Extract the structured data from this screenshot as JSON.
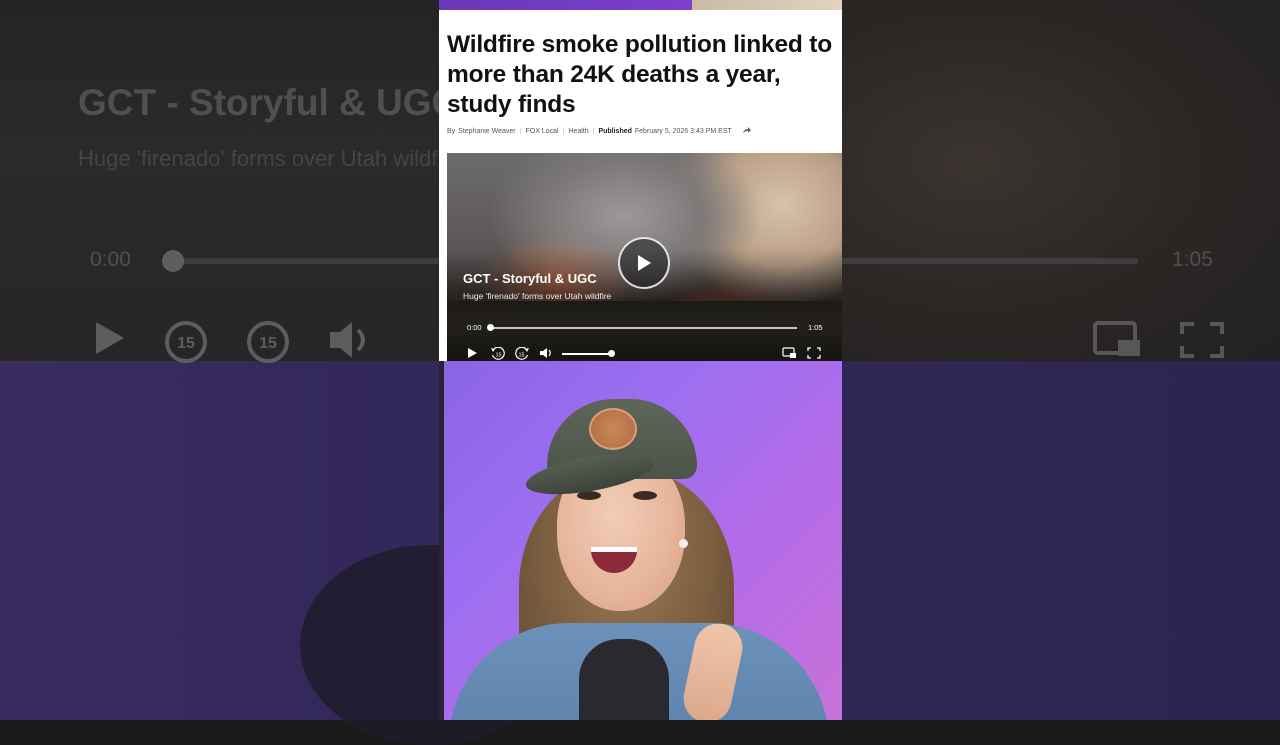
{
  "background_ghost": {
    "title": "GCT - Storyful & UGC",
    "subtitle": "Huge 'firenado' forms over Utah wildfire",
    "time_current": "0:00",
    "time_duration": "1:05"
  },
  "article": {
    "headline": "Wildfire smoke pollution linked to more than 24K deaths a year, study finds",
    "byline": {
      "by": "By",
      "author": "Stephanie Weaver",
      "outlet": "FOX Local",
      "category": "Health",
      "published_label": "Published",
      "published_date": "February 5, 2026 3:43 PM EST"
    }
  },
  "video": {
    "title": "GCT - Storyful & UGC",
    "subtitle": "Huge 'firenado' forms over Utah wildfire",
    "time_current": "0:00",
    "time_duration": "1:05",
    "progress": 0.0,
    "volume": 0.95,
    "skip_back_seconds": "15",
    "skip_forward_seconds": "15"
  },
  "icons": [
    "play-icon",
    "rewind-15-icon",
    "forward-15-icon",
    "volume-icon",
    "share-icon",
    "captions-icon",
    "fullscreen-icon"
  ],
  "colors": {
    "topbar": "#6a37b8",
    "presenter_bg": "#9d6ff0",
    "bg_bottom": "#33285a"
  }
}
